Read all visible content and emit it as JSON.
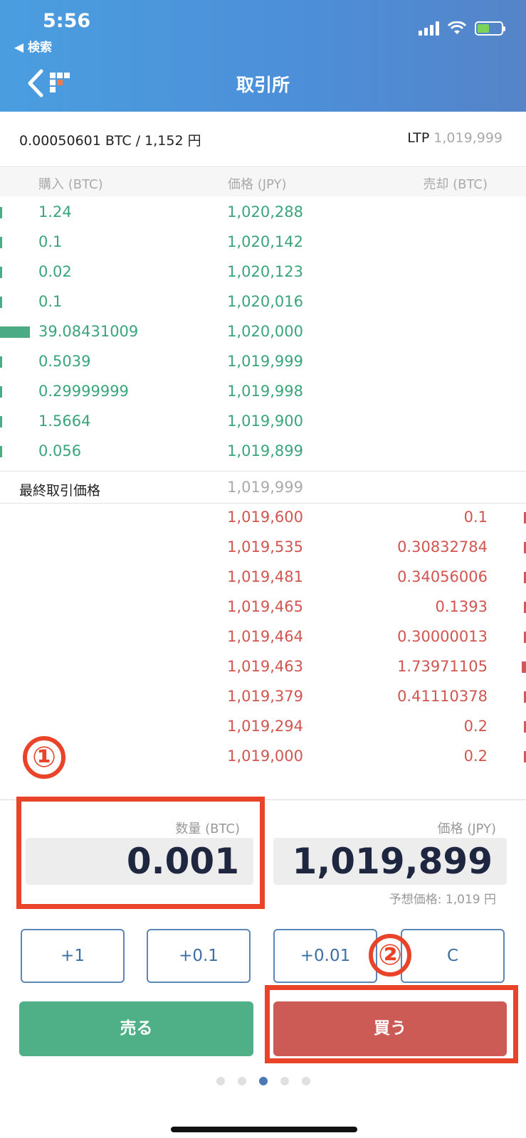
{
  "status": {
    "time": "5:56",
    "back_label": "◀ 検索"
  },
  "header": {
    "title": "取引所"
  },
  "balance": {
    "text": "0.00050601 BTC / 1,152 円",
    "ltp_label": "LTP",
    "ltp_value": "1,019,999"
  },
  "columns": {
    "buy": "購入 (BTC)",
    "price": "価格 (JPY)",
    "sell": "売却 (BTC)"
  },
  "bids": [
    {
      "qty": "1.24",
      "price": "1,020,288"
    },
    {
      "qty": "0.1",
      "price": "1,020,142"
    },
    {
      "qty": "0.02",
      "price": "1,020,123"
    },
    {
      "qty": "0.1",
      "price": "1,020,016"
    },
    {
      "qty": "39.08431009",
      "price": "1,020,000"
    },
    {
      "qty": "0.5039",
      "price": "1,019,999"
    },
    {
      "qty": "0.29999999",
      "price": "1,019,998"
    },
    {
      "qty": "1.5664",
      "price": "1,019,900"
    },
    {
      "qty": "0.056",
      "price": "1,019,899"
    }
  ],
  "last_trade": {
    "label": "最終取引価格",
    "value": "1,019,999"
  },
  "asks": [
    {
      "price": "1,019,600",
      "qty": "0.1"
    },
    {
      "price": "1,019,535",
      "qty": "0.30832784"
    },
    {
      "price": "1,019,481",
      "qty": "0.34056006"
    },
    {
      "price": "1,019,465",
      "qty": "0.1393"
    },
    {
      "price": "1,019,464",
      "qty": "0.30000013"
    },
    {
      "price": "1,019,463",
      "qty": "1.73971105"
    },
    {
      "price": "1,019,379",
      "qty": "0.41110378"
    },
    {
      "price": "1,019,294",
      "qty": "0.2"
    },
    {
      "price": "1,019,000",
      "qty": "0.2"
    }
  ],
  "order": {
    "qty_label": "数量 (BTC)",
    "qty_value": "0.001",
    "price_label": "価格 (JPY)",
    "price_value": "1,019,899",
    "estimate": "予想価格: 1,019 円"
  },
  "increments": [
    "+1",
    "+0.1",
    "+0.01",
    "C"
  ],
  "actions": {
    "sell": "売る",
    "buy": "買う"
  },
  "annotations": {
    "one": "①",
    "two": "②"
  },
  "colors": {
    "bid": "#3aa57a",
    "ask": "#d2554f",
    "annotation": "#e9442a",
    "header": "#4a9ee0"
  }
}
